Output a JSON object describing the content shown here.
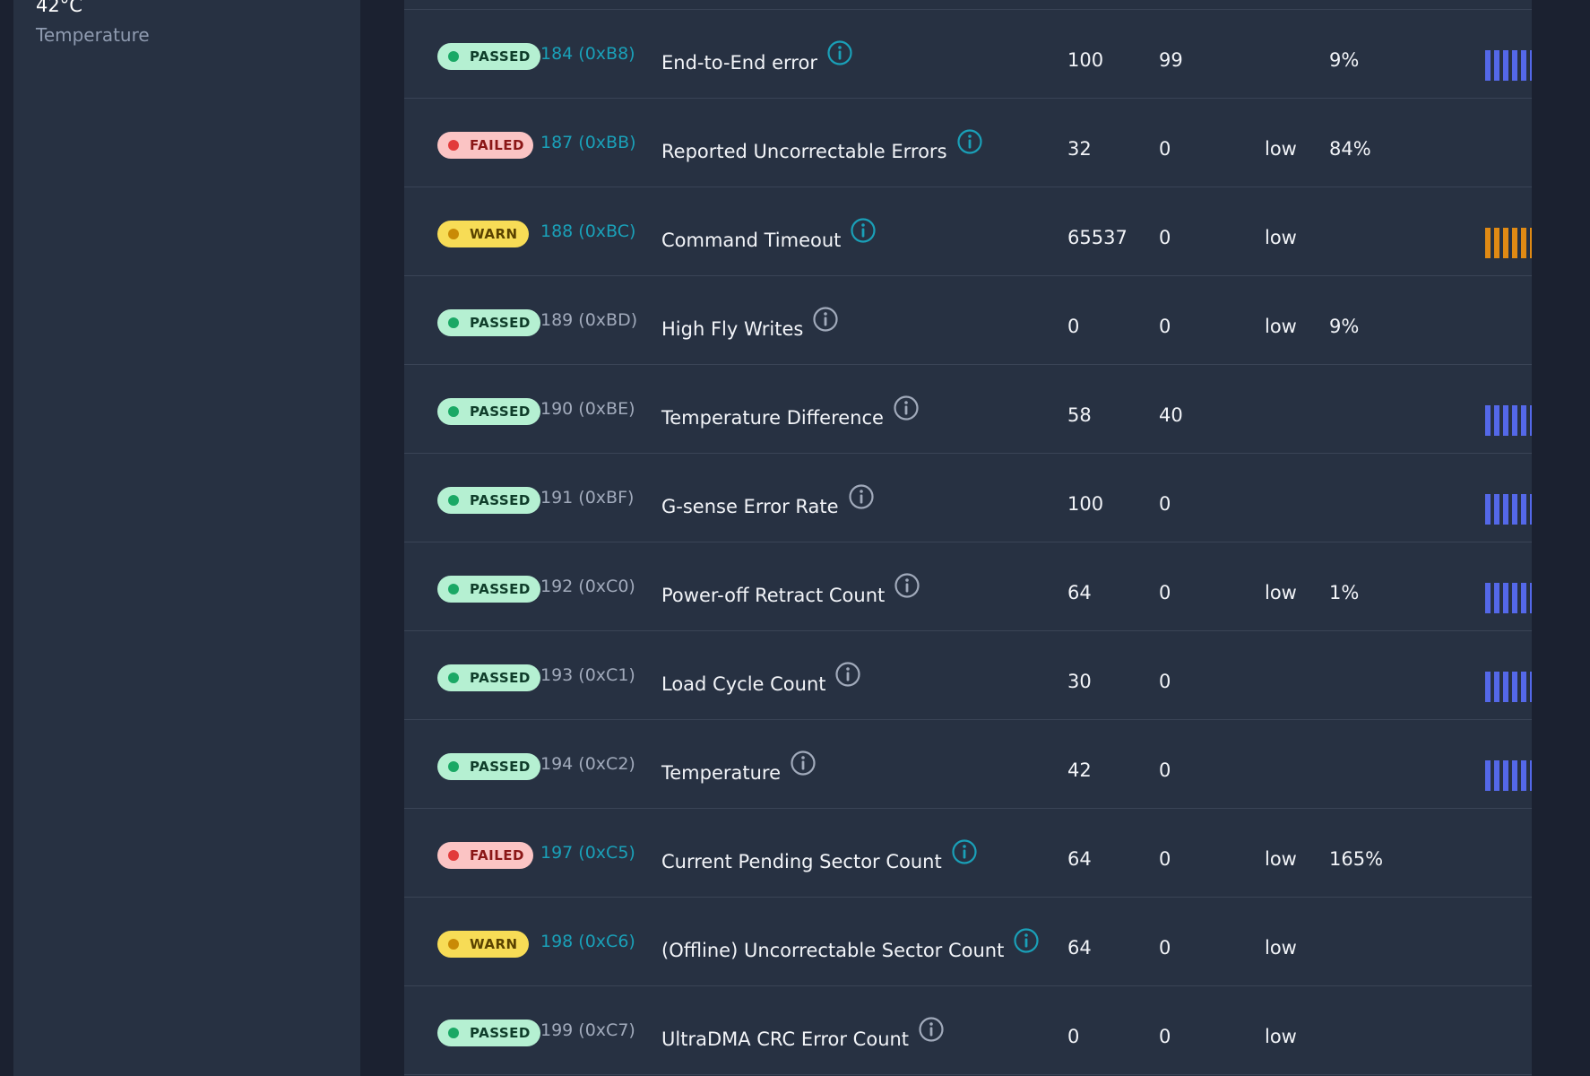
{
  "sidebar": {
    "temperature_value": "42°C",
    "temperature_label": "Temperature"
  },
  "colors": {
    "passed": "#b5f0d2",
    "failed": "#fbc4c4",
    "warn": "#f7dc56",
    "id_teal": "#1aa0b8",
    "bar_blue": "#5468e8",
    "bar_orange": "#e08a14"
  },
  "rows": [
    {
      "status": "PASSED",
      "id": "184 (0xB8)",
      "name": "End-to-End error",
      "value": "100",
      "worst": "99",
      "threshold": "",
      "percent": "9%",
      "bar": "blue",
      "id_color": "teal"
    },
    {
      "status": "FAILED",
      "id": "187 (0xBB)",
      "name": "Reported Uncorrectable Errors",
      "value": "32",
      "worst": "0",
      "threshold": "low",
      "percent": "84%",
      "bar": "",
      "id_color": "teal"
    },
    {
      "status": "WARN",
      "id": "188 (0xBC)",
      "name": "Command Timeout",
      "value": "65537",
      "worst": "0",
      "threshold": "low",
      "percent": "",
      "bar": "orange",
      "id_color": "teal"
    },
    {
      "status": "PASSED",
      "id": "189 (0xBD)",
      "name": "High Fly Writes",
      "value": "0",
      "worst": "0",
      "threshold": "low",
      "percent": "9%",
      "bar": "",
      "id_color": "gray"
    },
    {
      "status": "PASSED",
      "id": "190 (0xBE)",
      "name": "Temperature Difference",
      "value": "58",
      "worst": "40",
      "threshold": "",
      "percent": "",
      "bar": "blue",
      "id_color": "gray"
    },
    {
      "status": "PASSED",
      "id": "191 (0xBF)",
      "name": "G-sense Error Rate",
      "value": "100",
      "worst": "0",
      "threshold": "",
      "percent": "",
      "bar": "blue",
      "id_color": "gray"
    },
    {
      "status": "PASSED",
      "id": "192 (0xC0)",
      "name": "Power-off Retract Count",
      "value": "64",
      "worst": "0",
      "threshold": "low",
      "percent": "1%",
      "bar": "blue",
      "id_color": "gray"
    },
    {
      "status": "PASSED",
      "id": "193 (0xC1)",
      "name": "Load Cycle Count",
      "value": "30",
      "worst": "0",
      "threshold": "",
      "percent": "",
      "bar": "blue",
      "id_color": "gray"
    },
    {
      "status": "PASSED",
      "id": "194 (0xC2)",
      "name": "Temperature",
      "value": "42",
      "worst": "0",
      "threshold": "",
      "percent": "",
      "bar": "blue",
      "id_color": "gray"
    },
    {
      "status": "FAILED",
      "id": "197 (0xC5)",
      "name": "Current Pending Sector Count",
      "value": "64",
      "worst": "0",
      "threshold": "low",
      "percent": "165%",
      "bar": "",
      "id_color": "teal"
    },
    {
      "status": "WARN",
      "id": "198 (0xC6)",
      "name": "(Offline) Uncorrectable Sector Count",
      "value": "64",
      "worst": "0",
      "threshold": "low",
      "percent": "",
      "bar": "",
      "id_color": "teal"
    },
    {
      "status": "PASSED",
      "id": "199 (0xC7)",
      "name": "UltraDMA CRC Error Count",
      "value": "0",
      "worst": "0",
      "threshold": "low",
      "percent": "",
      "bar": "",
      "id_color": "gray"
    }
  ]
}
